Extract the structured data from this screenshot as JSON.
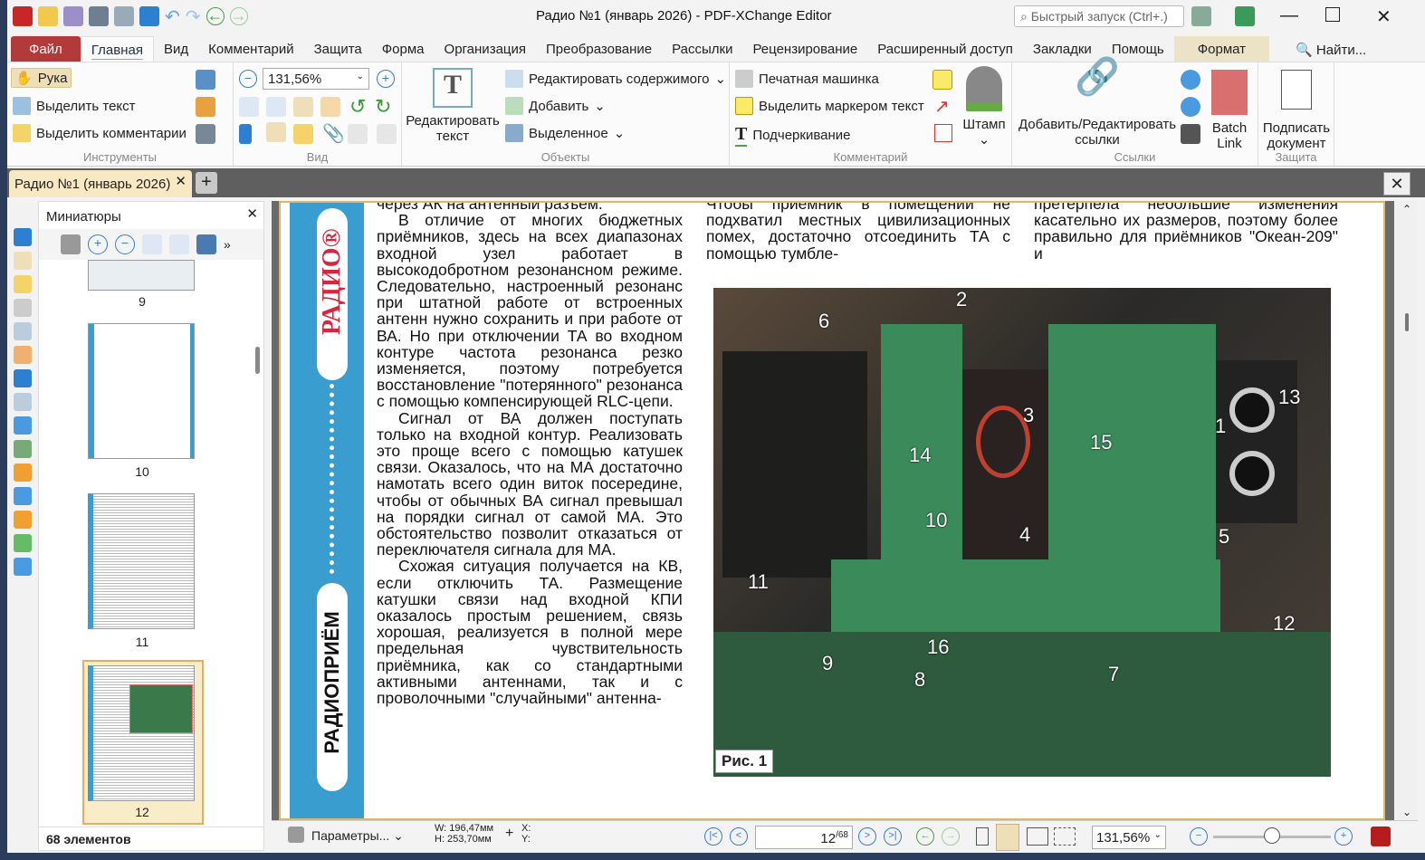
{
  "window": {
    "title": "Радио №1 (январь 2026) - PDF-XChange Editor",
    "search_placeholder": "Быстрый запуск (Ctrl+.)"
  },
  "menu": [
    "Файл",
    "Главная",
    "Вид",
    "Комментарий",
    "Защита",
    "Форма",
    "Организация",
    "Преобразование",
    "Рассылки",
    "Рецензирование",
    "Расширенный доступ",
    "Закладки",
    "Помощь",
    "Формат"
  ],
  "menu_find": "Найти...",
  "ribbon": {
    "tools": {
      "hand": "Рука",
      "select_text": "Выделить текст",
      "select_comments": "Выделить комментарии",
      "label": "Инструменты"
    },
    "view": {
      "zoom": "131,56%",
      "label": "Вид"
    },
    "objects": {
      "edit_text": "Редактировать текст",
      "edit_content": "Редактировать содержимого",
      "add": "Добавить",
      "selected": "Выделенное",
      "label": "Объекты"
    },
    "comments": {
      "typewriter": "Печатная машинка",
      "highlight": "Выделить маркером текст",
      "underline": "Подчеркивание",
      "stamp": "Штамп",
      "label": "Комментарий"
    },
    "links": {
      "add_edit": "Добавить/Редактировать ссылки",
      "batch": "Batch Link",
      "label": "Ссылки"
    },
    "protect": {
      "sign": "Подписать документ",
      "label": "Защита"
    }
  },
  "doc_tab": "Радио №1 (январь 2026)",
  "thumbnails": {
    "title": "Миниатюры",
    "pages": [
      "9",
      "10",
      "11",
      "12"
    ],
    "selected": "12",
    "count": "68 элементов"
  },
  "page": {
    "band_logo": "РАДИО®",
    "band_section": "РАДИОПРИЁМ",
    "col1": [
      "через АК на антенный разъем.",
      "В отличие от многих бюджетных приёмников, здесь на всех диапазонах входной узел работает в высокодобротном резонансном режиме. Следовательно, настроенный резонанс при штатной работе от встроенных антенн нужно сохранить и при работе от ВА. Но при отключении ТА во входном контуре частота резонанса резко изменяется, поэтому потребуется восстановление \"потерянного\" резонанса с помощью компенсирующей RLC-цепи.",
      "Сигнал от ВА должен поступать только на входной контур. Реализовать это проще всего с помощью катушек связи. Оказалось, что на МА достаточно намотать всего один виток посередине, чтобы от обычных ВА сигнал превышал на порядки сигнал от самой МА. Это обстоятельство позволит отказаться от переключателя сигнала для МА.",
      "Схожая ситуация получается на КВ, если отключить ТА. Размещение катушки связи над входной КПИ оказалось простым решением, связь хорошая, реализуется в полной мере предельная чувствительность приёмника, как со стандартными активными антеннами, так и с проволочными \"случайными\" антенна-"
    ],
    "col2": "Чтобы приемник в помещении не подхватил местных цивилизационных помех, достаточно отсоединить ТА с помощью тумбле-",
    "col3": "претерпела небольшие изменения касательно их размеров, поэтому более правильно для приёмников \"Океан-209\" и",
    "figure_caption": "Рис. 1",
    "photo_labels": [
      "1",
      "2",
      "3",
      "4",
      "5",
      "6",
      "7",
      "8",
      "9",
      "10",
      "11",
      "12",
      "13",
      "14",
      "15",
      "16"
    ]
  },
  "status": {
    "options": "Параметры...",
    "w": "W: 196,47мм",
    "h": "H: 253,70мм",
    "x": "X:",
    "y": "Y:",
    "page_current": "12",
    "page_total": "/68",
    "zoom": "131,56%"
  }
}
